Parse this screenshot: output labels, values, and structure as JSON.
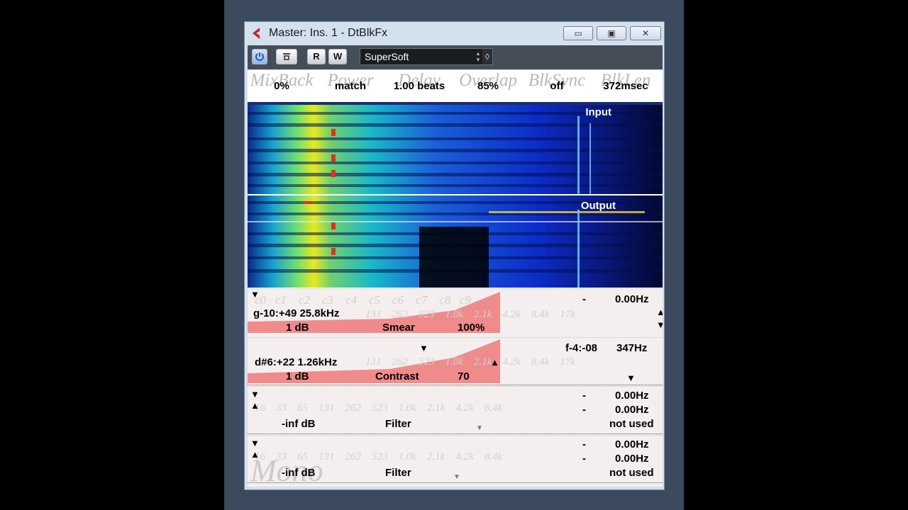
{
  "window": {
    "title": "Master: Ins. 1 - DtBlkFx",
    "controls": {
      "minimize": "▭",
      "maximize": "▣",
      "close": "✕"
    }
  },
  "toolbar": {
    "power_icon": "power-icon",
    "bypass_icon": "bypass-icon",
    "read_label": "R",
    "write_label": "W",
    "preset_name": "SuperSoft"
  },
  "params": [
    {
      "label": "MixBack",
      "value": "0%"
    },
    {
      "label": "Power",
      "value": "match"
    },
    {
      "label": "Delay",
      "value": "1.00 beats"
    },
    {
      "label": "Overlap",
      "value": "85%"
    },
    {
      "label": "BlkSync",
      "value": "off"
    },
    {
      "label": "BlkLen",
      "value": "372msec"
    }
  ],
  "spectrogram": {
    "input_label": "Input",
    "output_label": "Output"
  },
  "freq_ticks": [
    "131",
    "262",
    "523",
    "1.0k",
    "2.1k",
    "4.2k",
    "8.4k",
    "17k"
  ],
  "freq_ticks_low": [
    "16",
    "33",
    "65",
    "131",
    "262",
    "523",
    "1.0k",
    "2.1k",
    "4.2k",
    "8.4k"
  ],
  "note_ticks": [
    "c0",
    "c1",
    "c2",
    "c3",
    "c4",
    "c5",
    "c6",
    "c7",
    "c8",
    "c9"
  ],
  "fx1": {
    "left_freq": "g-10:+49 25.8kHz",
    "gain": "1 dB",
    "effect": "Smear",
    "amount": "100%",
    "right_dash": "-",
    "right_freq": "0.00Hz"
  },
  "fx2": {
    "left_freq": "d#6:+22 1.26kHz",
    "gain": "1 dB",
    "effect": "Contrast",
    "amount": "70",
    "right_note": "f-4:-08",
    "right_freq": "347Hz"
  },
  "fx3": {
    "gain": "-inf dB",
    "effect": "Filter",
    "dash1": "-",
    "freq1": "0.00Hz",
    "dash2": "-",
    "freq2": "0.00Hz",
    "status": "not used"
  },
  "fx4": {
    "gain": "-inf dB",
    "effect": "Filter",
    "dash1": "-",
    "freq1": "0.00Hz",
    "dash2": "-",
    "freq2": "0.00Hz",
    "status": "not used",
    "mode_watermark": "Mono"
  },
  "colors": {
    "accent_red": "#f08080",
    "toolbar": "#454d59",
    "window": "#d3e0ee"
  }
}
